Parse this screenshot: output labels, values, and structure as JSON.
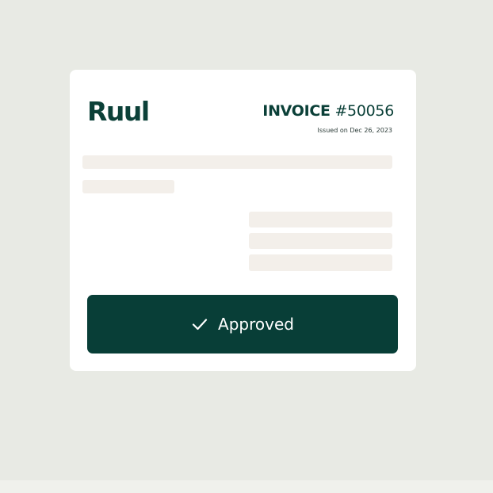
{
  "brand": {
    "logo_text": "Ruul",
    "color": "#0b4038"
  },
  "invoice": {
    "label": "INVOICE",
    "number": "#50056",
    "issued": "Issued on Dec 26, 2023"
  },
  "action": {
    "approved_label": "Approved",
    "icon": "check-icon",
    "button_color": "#083e37"
  },
  "colors": {
    "background": "#e8eae4",
    "card": "#ffffff",
    "placeholder": "#f3efea"
  }
}
